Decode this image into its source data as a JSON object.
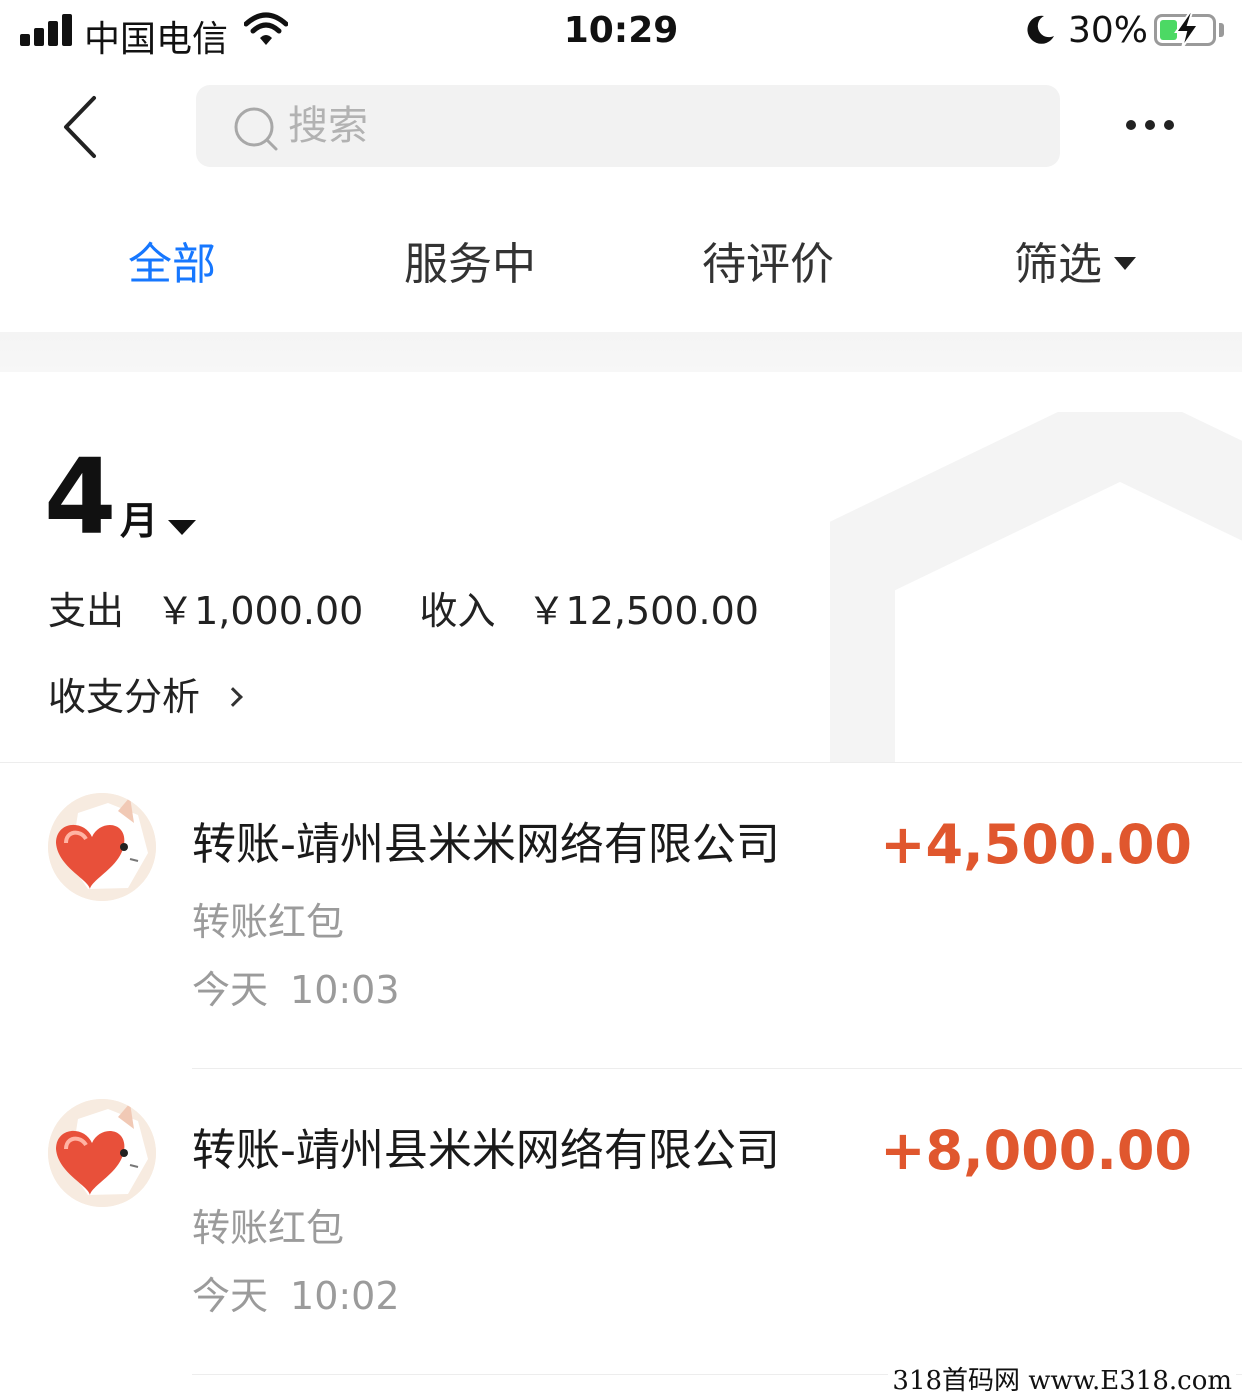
{
  "status_bar": {
    "carrier": "中国电信",
    "time": "10:29",
    "battery_percent": "30%",
    "battery_level": 0.3,
    "icons": [
      "signal-icon",
      "wifi-icon",
      "moon-icon",
      "battery-icon",
      "charging-bolt-icon"
    ]
  },
  "nav": {
    "back_icon": "chevron-left-icon",
    "search_placeholder": "搜索",
    "more_icon": "more-dots-icon"
  },
  "tabs": [
    {
      "label": "全部",
      "active": true
    },
    {
      "label": "服务中",
      "active": false
    },
    {
      "label": "待评价",
      "active": false
    },
    {
      "label": "筛选",
      "active": false,
      "icon": "caret-down-icon"
    }
  ],
  "month": {
    "number": "4",
    "unit": "月",
    "expense_label": "支出",
    "expense_value": "￥1,000.00",
    "income_label": "收入",
    "income_value": "￥12,500.00",
    "analysis_label": "收支分析"
  },
  "transactions": [
    {
      "title": "转账-靖州县米米网络有限公司",
      "amount": "+4,500.00",
      "category": "转账红包",
      "day": "今天",
      "time": "10:03"
    },
    {
      "title": "转账-靖州县米米网络有限公司",
      "amount": "+8,000.00",
      "category": "转账红包",
      "day": "今天",
      "time": "10:02"
    }
  ],
  "colors": {
    "accent": "#1677ff",
    "income": "#e0572e",
    "secondary_text": "#9b9b9b",
    "search_bg": "#f2f2f2"
  },
  "watermark": "318首码网  www.E318.com"
}
